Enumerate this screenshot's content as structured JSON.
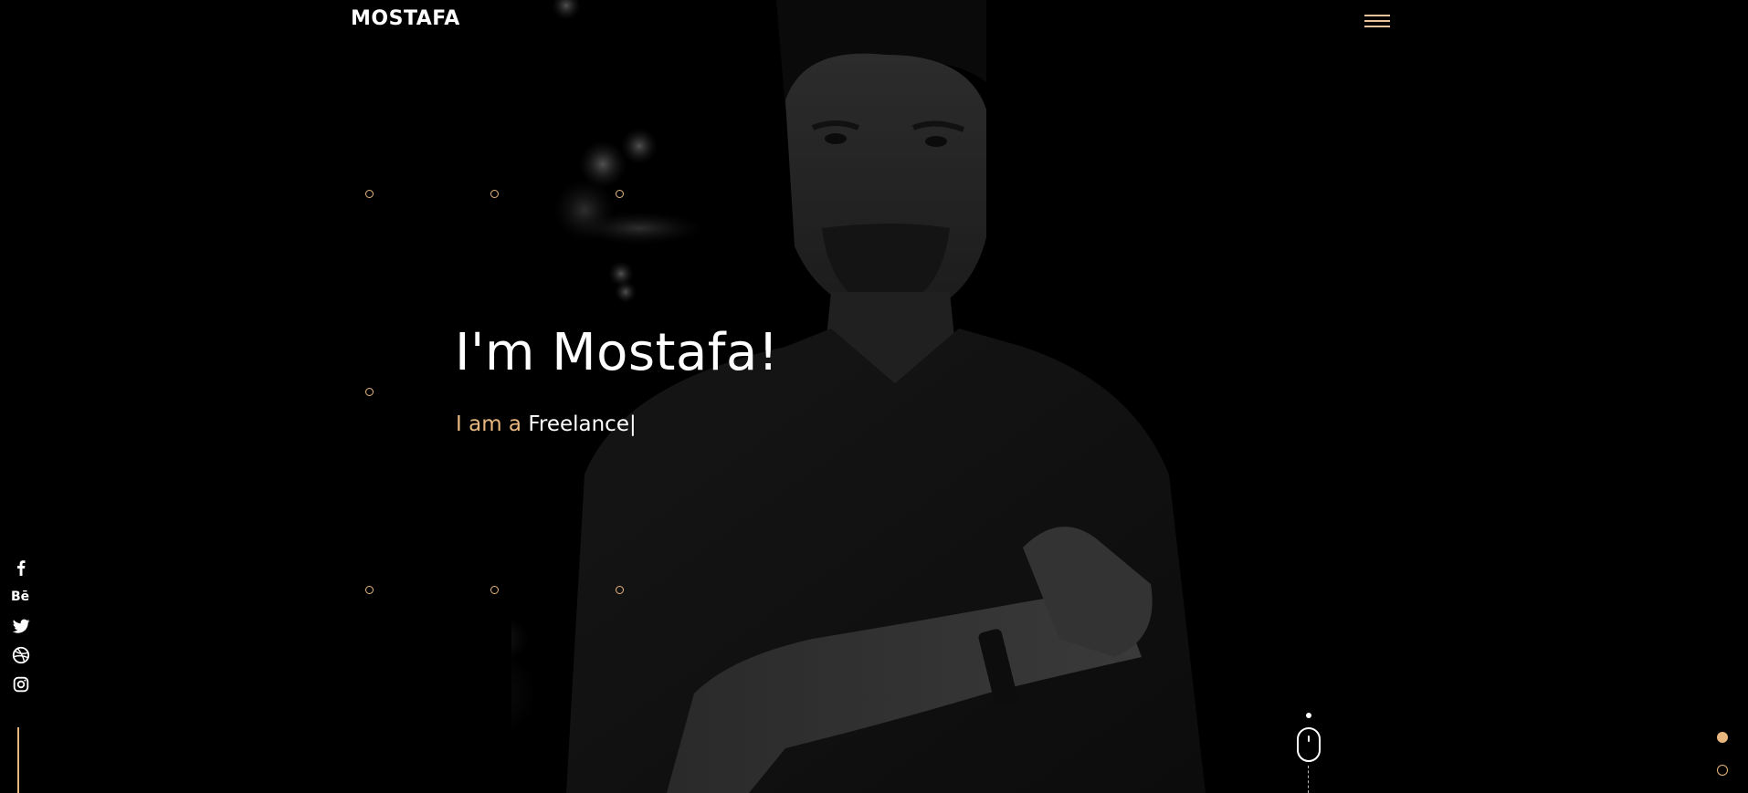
{
  "header": {
    "logo": "MOSTAFA",
    "menu_icon": "hamburger-icon"
  },
  "hero": {
    "title": "I'm Mostafa!",
    "subtitle_prefix": "I am a",
    "subtitle_role": "Freelance",
    "cursor": "|"
  },
  "social": {
    "items": [
      {
        "icon": "facebook-icon"
      },
      {
        "icon": "behance-icon",
        "glyph": "Bē"
      },
      {
        "icon": "twitter-icon"
      },
      {
        "icon": "dribbble-icon"
      },
      {
        "icon": "instagram-icon"
      }
    ]
  },
  "scroll_indicator": {
    "icon": "mouse-icon"
  },
  "pagination": {
    "count": 2,
    "active_index": 0
  },
  "colors": {
    "background": "#000000",
    "accent": "#e8b77f",
    "text": "#ffffff"
  }
}
